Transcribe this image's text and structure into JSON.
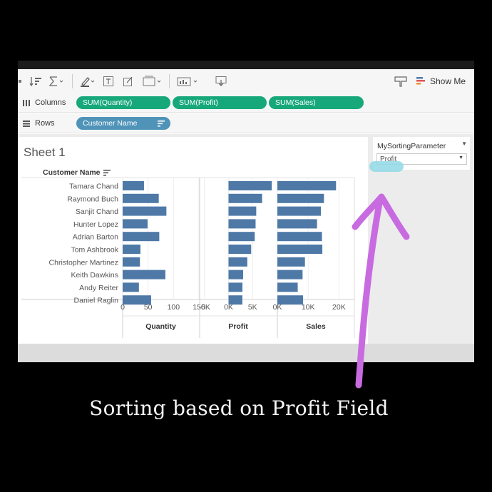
{
  "toolbar": {
    "show_me_label": "Show Me"
  },
  "shelves": {
    "columns_label": "Columns",
    "rows_label": "Rows",
    "columns_pills": [
      "SUM(Quantity)",
      "SUM(Profit)",
      "SUM(Sales)"
    ],
    "rows_pill": "Customer Name"
  },
  "sheet": {
    "title": "Sheet 1",
    "row_header": "Customer Name"
  },
  "parameter": {
    "title": "MySortingParameter",
    "selected": "Profit"
  },
  "caption": "Sorting based on Profit Field",
  "colors": {
    "bar": "#4e79a7",
    "pill_green": "#17a87a",
    "pill_blue": "#4f93b8",
    "arrow": "#c86be0",
    "highlight": "#8fd9e6"
  },
  "chart_data": {
    "type": "bar",
    "categories": [
      "Tamara Chand",
      "Raymond Buch",
      "Sanjit Chand",
      "Hunter Lopez",
      "Adrian Barton",
      "Tom Ashbrook",
      "Christopher Martinez",
      "Keith Dawkins",
      "Andy Reiter",
      "Daniel Raglin"
    ],
    "series": [
      {
        "name": "Quantity",
        "values": [
          42,
          71,
          86,
          49,
          72,
          35,
          34,
          84,
          32,
          56
        ],
        "ticks": [
          0,
          50,
          100,
          150
        ],
        "tick_labels": [
          "0",
          "50",
          "100",
          "150"
        ],
        "xlim": [
          0,
          150
        ]
      },
      {
        "name": "Profit",
        "values": [
          8981,
          6976,
          5757,
          5622,
          5444,
          4704,
          3900,
          3039,
          2884,
          2870
        ],
        "ticks": [
          -5000,
          0,
          5000
        ],
        "tick_labels": [
          "-5K",
          "0K",
          "5K"
        ],
        "xlim": [
          -6000,
          10000
        ]
      },
      {
        "name": "Sales",
        "values": [
          19052,
          15117,
          14142,
          12873,
          14474,
          14596,
          8954,
          8181,
          6608,
          8351
        ],
        "ticks": [
          0,
          10000,
          20000
        ],
        "tick_labels": [
          "0K",
          "10K",
          "20K"
        ],
        "xlim": [
          0,
          25000
        ]
      }
    ]
  }
}
